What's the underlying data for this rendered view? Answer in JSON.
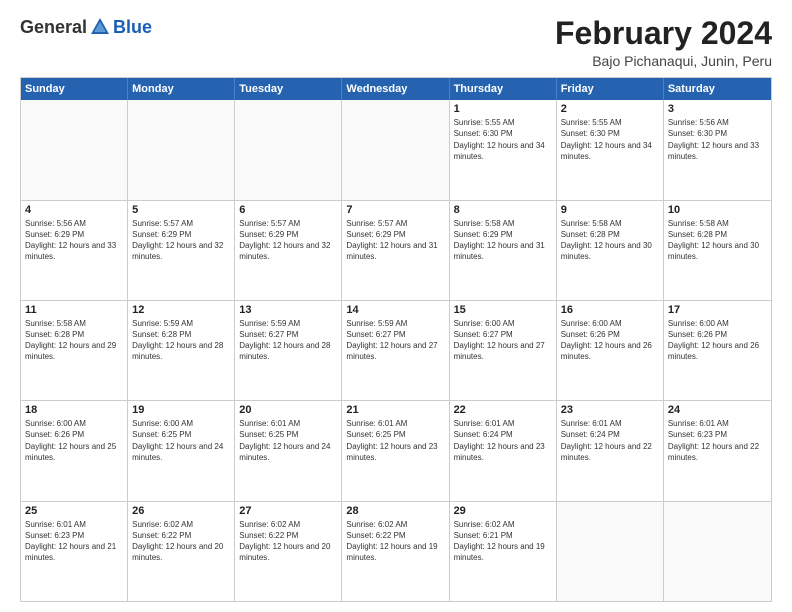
{
  "logo": {
    "general": "General",
    "blue": "Blue"
  },
  "title": "February 2024",
  "subtitle": "Bajo Pichanaqui, Junin, Peru",
  "days": [
    "Sunday",
    "Monday",
    "Tuesday",
    "Wednesday",
    "Thursday",
    "Friday",
    "Saturday"
  ],
  "rows": [
    [
      {
        "day": "",
        "empty": true
      },
      {
        "day": "",
        "empty": true
      },
      {
        "day": "",
        "empty": true
      },
      {
        "day": "",
        "empty": true
      },
      {
        "day": "1",
        "sunrise": "5:55 AM",
        "sunset": "6:30 PM",
        "daylight": "12 hours and 34 minutes."
      },
      {
        "day": "2",
        "sunrise": "5:55 AM",
        "sunset": "6:30 PM",
        "daylight": "12 hours and 34 minutes."
      },
      {
        "day": "3",
        "sunrise": "5:56 AM",
        "sunset": "6:30 PM",
        "daylight": "12 hours and 33 minutes."
      }
    ],
    [
      {
        "day": "4",
        "sunrise": "5:56 AM",
        "sunset": "6:29 PM",
        "daylight": "12 hours and 33 minutes."
      },
      {
        "day": "5",
        "sunrise": "5:57 AM",
        "sunset": "6:29 PM",
        "daylight": "12 hours and 32 minutes."
      },
      {
        "day": "6",
        "sunrise": "5:57 AM",
        "sunset": "6:29 PM",
        "daylight": "12 hours and 32 minutes."
      },
      {
        "day": "7",
        "sunrise": "5:57 AM",
        "sunset": "6:29 PM",
        "daylight": "12 hours and 31 minutes."
      },
      {
        "day": "8",
        "sunrise": "5:58 AM",
        "sunset": "6:29 PM",
        "daylight": "12 hours and 31 minutes."
      },
      {
        "day": "9",
        "sunrise": "5:58 AM",
        "sunset": "6:28 PM",
        "daylight": "12 hours and 30 minutes."
      },
      {
        "day": "10",
        "sunrise": "5:58 AM",
        "sunset": "6:28 PM",
        "daylight": "12 hours and 30 minutes."
      }
    ],
    [
      {
        "day": "11",
        "sunrise": "5:58 AM",
        "sunset": "6:28 PM",
        "daylight": "12 hours and 29 minutes."
      },
      {
        "day": "12",
        "sunrise": "5:59 AM",
        "sunset": "6:28 PM",
        "daylight": "12 hours and 28 minutes."
      },
      {
        "day": "13",
        "sunrise": "5:59 AM",
        "sunset": "6:27 PM",
        "daylight": "12 hours and 28 minutes."
      },
      {
        "day": "14",
        "sunrise": "5:59 AM",
        "sunset": "6:27 PM",
        "daylight": "12 hours and 27 minutes."
      },
      {
        "day": "15",
        "sunrise": "6:00 AM",
        "sunset": "6:27 PM",
        "daylight": "12 hours and 27 minutes."
      },
      {
        "day": "16",
        "sunrise": "6:00 AM",
        "sunset": "6:26 PM",
        "daylight": "12 hours and 26 minutes."
      },
      {
        "day": "17",
        "sunrise": "6:00 AM",
        "sunset": "6:26 PM",
        "daylight": "12 hours and 26 minutes."
      }
    ],
    [
      {
        "day": "18",
        "sunrise": "6:00 AM",
        "sunset": "6:26 PM",
        "daylight": "12 hours and 25 minutes."
      },
      {
        "day": "19",
        "sunrise": "6:00 AM",
        "sunset": "6:25 PM",
        "daylight": "12 hours and 24 minutes."
      },
      {
        "day": "20",
        "sunrise": "6:01 AM",
        "sunset": "6:25 PM",
        "daylight": "12 hours and 24 minutes."
      },
      {
        "day": "21",
        "sunrise": "6:01 AM",
        "sunset": "6:25 PM",
        "daylight": "12 hours and 23 minutes."
      },
      {
        "day": "22",
        "sunrise": "6:01 AM",
        "sunset": "6:24 PM",
        "daylight": "12 hours and 23 minutes."
      },
      {
        "day": "23",
        "sunrise": "6:01 AM",
        "sunset": "6:24 PM",
        "daylight": "12 hours and 22 minutes."
      },
      {
        "day": "24",
        "sunrise": "6:01 AM",
        "sunset": "6:23 PM",
        "daylight": "12 hours and 22 minutes."
      }
    ],
    [
      {
        "day": "25",
        "sunrise": "6:01 AM",
        "sunset": "6:23 PM",
        "daylight": "12 hours and 21 minutes."
      },
      {
        "day": "26",
        "sunrise": "6:02 AM",
        "sunset": "6:22 PM",
        "daylight": "12 hours and 20 minutes."
      },
      {
        "day": "27",
        "sunrise": "6:02 AM",
        "sunset": "6:22 PM",
        "daylight": "12 hours and 20 minutes."
      },
      {
        "day": "28",
        "sunrise": "6:02 AM",
        "sunset": "6:22 PM",
        "daylight": "12 hours and 19 minutes."
      },
      {
        "day": "29",
        "sunrise": "6:02 AM",
        "sunset": "6:21 PM",
        "daylight": "12 hours and 19 minutes."
      },
      {
        "day": "",
        "empty": true
      },
      {
        "day": "",
        "empty": true
      }
    ]
  ],
  "labels": {
    "sunrise_prefix": "Sunrise: ",
    "sunset_prefix": "Sunset: ",
    "daylight_prefix": "Daylight: "
  }
}
